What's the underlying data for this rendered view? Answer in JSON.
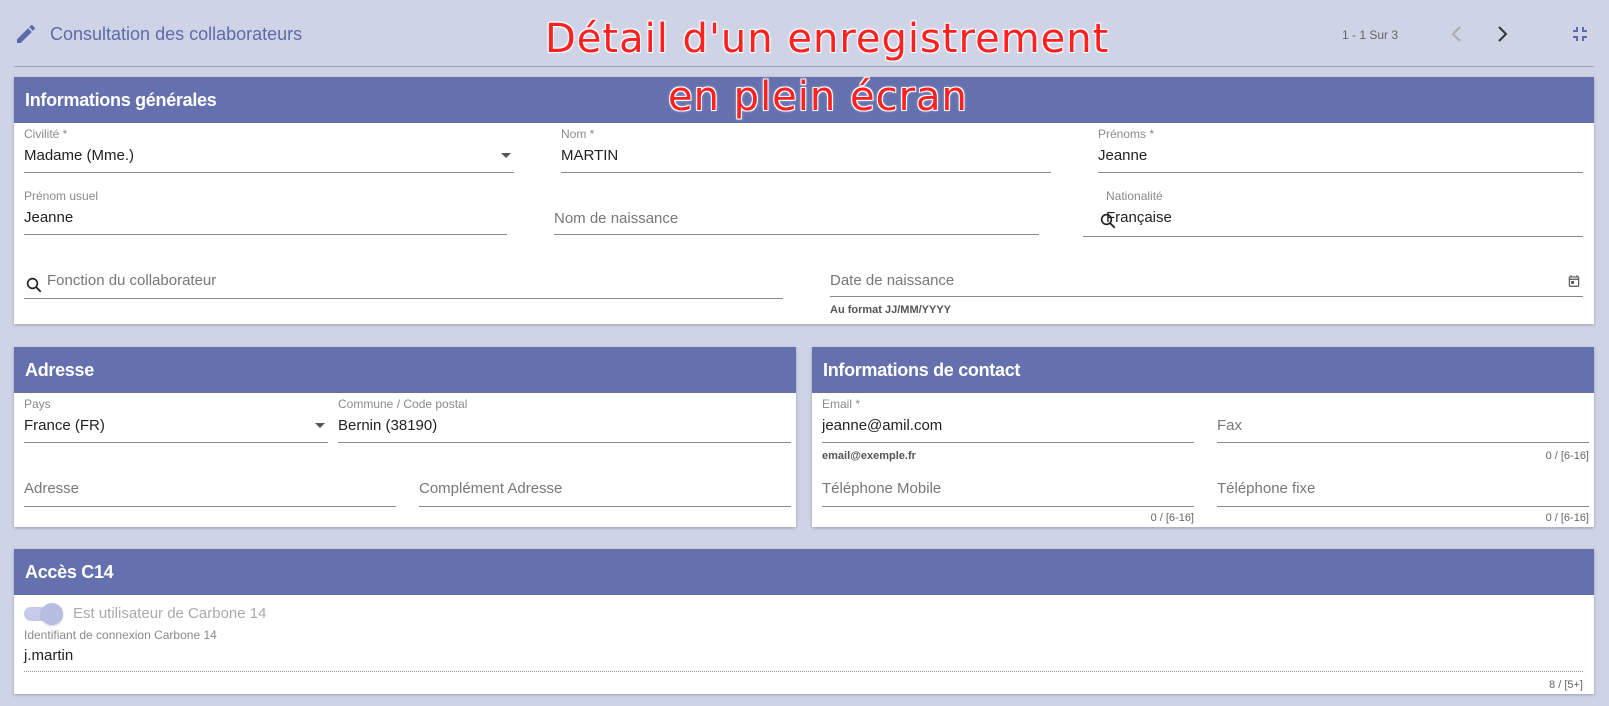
{
  "header": {
    "title": "Consultation des collaborateurs",
    "pager": "1 - 1 Sur 3",
    "overlay_line1": "Détail d'un enregistrement",
    "overlay_line2": "en plein écran",
    "icons": [
      "edit-icon",
      "chevron-left-icon",
      "chevron-right-icon",
      "fullscreen-exit-icon"
    ]
  },
  "general": {
    "heading": "Informations générales",
    "civilite": {
      "label": "Civilité *",
      "value": "Madame (Mme.)"
    },
    "nom": {
      "label": "Nom *",
      "value": "MARTIN"
    },
    "prenoms": {
      "label": "Prénoms *",
      "value": "Jeanne"
    },
    "prenom_usuel": {
      "label": "Prénom usuel",
      "value": "Jeanne"
    },
    "nom_naissance": {
      "placeholder": "Nom de naissance"
    },
    "nationalite": {
      "label": "Nationalité",
      "value": "Française"
    },
    "fonction": {
      "placeholder": "Fonction du collaborateur"
    },
    "date_naissance": {
      "placeholder": "Date de naissance",
      "hint": "Au format JJ/MM/YYYY"
    }
  },
  "adresse": {
    "heading": "Adresse",
    "pays": {
      "label": "Pays",
      "value": "France (FR)"
    },
    "commune": {
      "label": "Commune / Code postal",
      "value": "Bernin (38190)"
    },
    "adresse": {
      "placeholder": "Adresse"
    },
    "complement": {
      "placeholder": "Complément Adresse"
    }
  },
  "contact": {
    "heading": "Informations de contact",
    "email": {
      "label": "Email *",
      "value": "jeanne@amil.com",
      "hint": "email@exemple.fr"
    },
    "fax": {
      "placeholder": "Fax",
      "counter": "0 / [6-16]"
    },
    "mobile": {
      "placeholder": "Téléphone Mobile",
      "counter": "0 / [6-16]"
    },
    "fixe": {
      "placeholder": "Téléphone fixe",
      "counter": "0 / [6-16]"
    }
  },
  "acces": {
    "heading": "Accès C14",
    "toggle_label": "Est utilisateur de Carbone 14",
    "toggle_on": true,
    "identifiant": {
      "label": "Identifiant de connexion Carbone 14",
      "value": "j.martin",
      "counter": "8 / [5+]"
    }
  },
  "colors": {
    "header_band": "#6471ae",
    "background": "#cfd3e6",
    "title_text": "#5c6bab",
    "overlay_text": "#ff2020"
  }
}
